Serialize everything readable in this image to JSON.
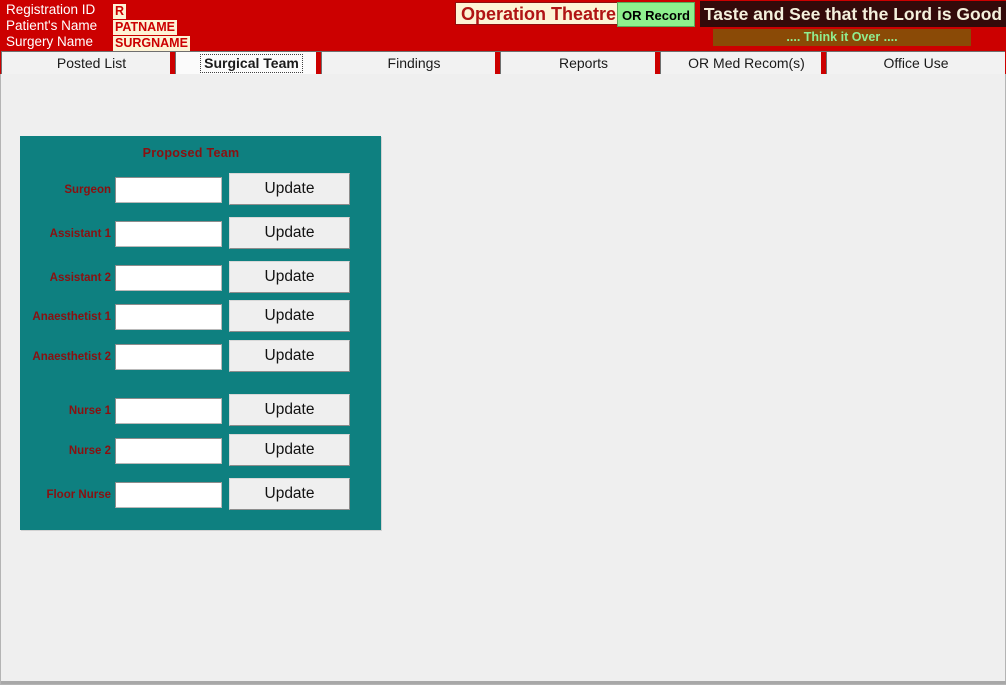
{
  "header": {
    "fields": [
      {
        "label": "Registration ID",
        "value": "R"
      },
      {
        "label": "Patient's Name",
        "value": "PATNAME"
      },
      {
        "label": "Surgery Name",
        "value": "SURGNAME"
      }
    ],
    "app_title": "Operation Theatre",
    "record_button": "OR Record",
    "banner_primary": "Taste and See that the Lord is Good",
    "banner_secondary": ".... Think it Over ....",
    "colors": {
      "header_bg": "#cc0000",
      "value_bg": "#fdf3d5",
      "title_text": "#b01414",
      "record_bg": "#8ef08e",
      "banner_bg": "#330a0a",
      "banner_text": "#f4f0dd",
      "secondary_bg": "#8a4a06",
      "secondary_text": "#90ee90"
    }
  },
  "tabs": [
    {
      "label": "Posted List",
      "active": false
    },
    {
      "label": "Surgical Team",
      "active": true
    },
    {
      "label": "Findings",
      "active": false
    },
    {
      "label": "Reports",
      "active": false
    },
    {
      "label": "OR Med Recom(s)",
      "active": false
    },
    {
      "label": "Office Use",
      "active": false
    }
  ],
  "panel": {
    "title": "Proposed Team",
    "background": "#0e8080",
    "label_color": "#8b1010",
    "update_label": "Update",
    "rows": [
      {
        "label": "Surgeon",
        "value": "",
        "placeholder": "",
        "button": "Update"
      },
      {
        "label": "Assistant 1",
        "value": "",
        "placeholder": "",
        "button": "Update"
      },
      {
        "label": "Assistant 2",
        "value": "",
        "placeholder": "",
        "button": "Update"
      },
      {
        "label": "Anaesthetist 1",
        "value": "",
        "placeholder": "",
        "button": "Update"
      },
      {
        "label": "Anaesthetist 2",
        "value": "",
        "placeholder": "",
        "button": "Update"
      },
      {
        "label": "Nurse 1",
        "value": "",
        "placeholder": "",
        "button": "Update"
      },
      {
        "label": "Nurse 2",
        "value": "",
        "placeholder": "",
        "button": "Update"
      },
      {
        "label": "Floor Nurse",
        "value": "",
        "placeholder": "",
        "button": "Update"
      }
    ]
  }
}
